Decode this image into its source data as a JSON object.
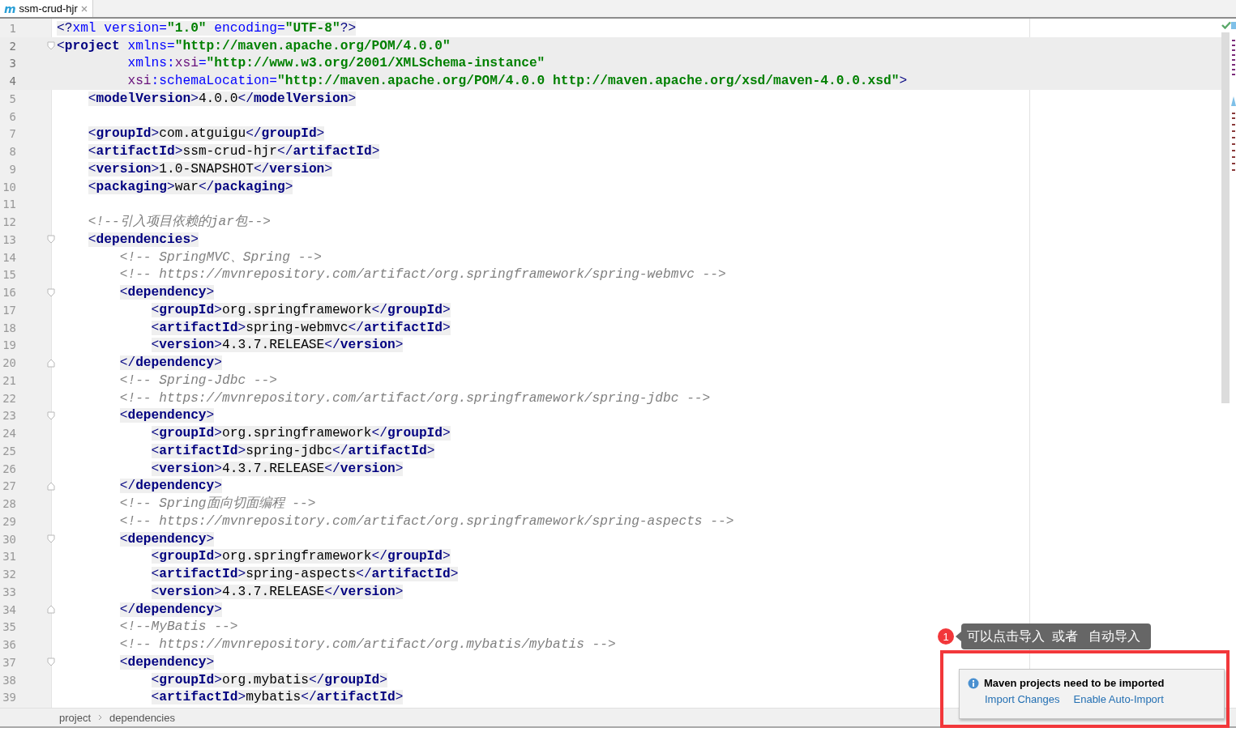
{
  "tabs": [
    {
      "icon": "m",
      "label": "ssm-crud-hjr",
      "selected": true
    }
  ],
  "lines": [
    {
      "number": "1",
      "highlighted": false,
      "fold_start": false,
      "fold_end": false,
      "tokens": [
        {
          "kind": "punct",
          "text": "<?"
        },
        {
          "kind": "attr",
          "text": "xml version="
        },
        {
          "kind": "value",
          "text": "\"1.0\""
        },
        {
          "kind": "attr",
          "text": " encoding="
        },
        {
          "kind": "value",
          "text": "\"UTF-8\""
        },
        {
          "kind": "punct",
          "text": "?>"
        }
      ]
    },
    {
      "number": "2",
      "highlighted": true,
      "fold_start": true,
      "fold_end": false,
      "tokens": [
        {
          "kind": "punct",
          "text": "<"
        },
        {
          "kind": "tag",
          "text": "project"
        },
        {
          "kind": "attr",
          "text": " xmlns="
        },
        {
          "kind": "value",
          "text": "\"http://maven.apache.org/POM/4.0.0\""
        }
      ]
    },
    {
      "number": "3",
      "highlighted": true,
      "fold_start": false,
      "fold_end": false,
      "tokens": [
        {
          "kind": "attr",
          "text": "         xmlns:"
        },
        {
          "kind": "ns",
          "text": "xsi"
        },
        {
          "kind": "attr",
          "text": "="
        },
        {
          "kind": "value",
          "text": "\"http://www.w3.org/2001/XMLSchema-instance\""
        }
      ]
    },
    {
      "number": "4",
      "highlighted": true,
      "fold_start": false,
      "fold_end": false,
      "tokens": [
        {
          "kind": "ns",
          "text": "         xsi"
        },
        {
          "kind": "attr",
          "text": ":schemaLocation="
        },
        {
          "kind": "value",
          "text": "\"http://maven.apache.org/POM/4.0.0 http://maven.apache.org/xsd/maven-4.0.0.xsd\""
        },
        {
          "kind": "punct",
          "text": ">"
        }
      ]
    },
    {
      "number": "5",
      "highlighted": false,
      "fold_start": false,
      "fold_end": false,
      "tokens": [
        {
          "kind": "punct",
          "text": "    <"
        },
        {
          "kind": "tag",
          "text": "modelVersion"
        },
        {
          "kind": "punct",
          "text": ">"
        },
        {
          "kind": "text",
          "text": "4.0.0"
        },
        {
          "kind": "punct",
          "text": "</"
        },
        {
          "kind": "tag",
          "text": "modelVersion"
        },
        {
          "kind": "punct",
          "text": ">"
        }
      ]
    },
    {
      "number": "6",
      "highlighted": false,
      "fold_start": false,
      "fold_end": false
    },
    {
      "number": "7",
      "highlighted": false,
      "fold_start": false,
      "fold_end": false,
      "tokens": [
        {
          "kind": "punct",
          "text": "    <"
        },
        {
          "kind": "tag",
          "text": "groupId"
        },
        {
          "kind": "punct",
          "text": ">"
        },
        {
          "kind": "text",
          "text": "com.atguigu"
        },
        {
          "kind": "punct",
          "text": "</"
        },
        {
          "kind": "tag",
          "text": "groupId"
        },
        {
          "kind": "punct",
          "text": ">"
        }
      ]
    },
    {
      "number": "8",
      "highlighted": false,
      "fold_start": false,
      "fold_end": false,
      "tokens": [
        {
          "kind": "punct",
          "text": "    <"
        },
        {
          "kind": "tag",
          "text": "artifactId"
        },
        {
          "kind": "punct",
          "text": ">"
        },
        {
          "kind": "text",
          "text": "ssm-crud-hjr"
        },
        {
          "kind": "punct",
          "text": "</"
        },
        {
          "kind": "tag",
          "text": "artifactId"
        },
        {
          "kind": "punct",
          "text": ">"
        }
      ]
    },
    {
      "number": "9",
      "highlighted": false,
      "fold_start": false,
      "fold_end": false,
      "tokens": [
        {
          "kind": "punct",
          "text": "    <"
        },
        {
          "kind": "tag",
          "text": "version"
        },
        {
          "kind": "punct",
          "text": ">"
        },
        {
          "kind": "text",
          "text": "1.0-SNAPSHOT"
        },
        {
          "kind": "punct",
          "text": "</"
        },
        {
          "kind": "tag",
          "text": "version"
        },
        {
          "kind": "punct",
          "text": ">"
        }
      ]
    },
    {
      "number": "10",
      "highlighted": false,
      "fold_start": false,
      "fold_end": false,
      "tokens": [
        {
          "kind": "punct",
          "text": "    <"
        },
        {
          "kind": "tag",
          "text": "packaging"
        },
        {
          "kind": "punct",
          "text": ">"
        },
        {
          "kind": "text",
          "text": "war"
        },
        {
          "kind": "punct",
          "text": "</"
        },
        {
          "kind": "tag",
          "text": "packaging"
        },
        {
          "kind": "punct",
          "text": ">"
        }
      ]
    },
    {
      "number": "11",
      "highlighted": false,
      "fold_start": false,
      "fold_end": false
    },
    {
      "number": "12",
      "highlighted": false,
      "fold_start": false,
      "fold_end": false,
      "tokens": [
        {
          "kind": "comment",
          "text": "    <!--引入项目依赖的jar包-->"
        }
      ]
    },
    {
      "number": "13",
      "highlighted": false,
      "fold_start": true,
      "fold_end": false,
      "tokens": [
        {
          "kind": "punct",
          "text": "    <"
        },
        {
          "kind": "tag",
          "text": "dependencies"
        },
        {
          "kind": "punct",
          "text": ">"
        }
      ]
    },
    {
      "number": "14",
      "highlighted": false,
      "fold_start": false,
      "fold_end": false,
      "tokens": [
        {
          "kind": "comment",
          "text": "        <!-- SpringMVC、Spring -->"
        }
      ]
    },
    {
      "number": "15",
      "highlighted": false,
      "fold_start": false,
      "fold_end": false,
      "tokens": [
        {
          "kind": "comment",
          "text": "        <!-- https://mvnrepository.com/artifact/org.springframework/spring-webmvc -->"
        }
      ]
    },
    {
      "number": "16",
      "highlighted": false,
      "fold_start": true,
      "fold_end": false,
      "tokens": [
        {
          "kind": "punct",
          "text": "        <"
        },
        {
          "kind": "tag",
          "text": "dependency"
        },
        {
          "kind": "punct",
          "text": ">"
        }
      ]
    },
    {
      "number": "17",
      "highlighted": false,
      "fold_start": false,
      "fold_end": false,
      "tokens": [
        {
          "kind": "punct",
          "text": "            <"
        },
        {
          "kind": "tag",
          "text": "groupId"
        },
        {
          "kind": "punct",
          "text": ">"
        },
        {
          "kind": "text",
          "text": "org.springframework"
        },
        {
          "kind": "punct",
          "text": "</"
        },
        {
          "kind": "tag",
          "text": "groupId"
        },
        {
          "kind": "punct",
          "text": ">"
        }
      ]
    },
    {
      "number": "18",
      "highlighted": false,
      "fold_start": false,
      "fold_end": false,
      "tokens": [
        {
          "kind": "punct",
          "text": "            <"
        },
        {
          "kind": "tag",
          "text": "artifactId"
        },
        {
          "kind": "punct",
          "text": ">"
        },
        {
          "kind": "text",
          "text": "spring-webmvc"
        },
        {
          "kind": "punct",
          "text": "</"
        },
        {
          "kind": "tag",
          "text": "artifactId"
        },
        {
          "kind": "punct",
          "text": ">"
        }
      ]
    },
    {
      "number": "19",
      "highlighted": false,
      "fold_start": false,
      "fold_end": false,
      "tokens": [
        {
          "kind": "punct",
          "text": "            <"
        },
        {
          "kind": "tag",
          "text": "version"
        },
        {
          "kind": "punct",
          "text": ">"
        },
        {
          "kind": "text",
          "text": "4.3.7.RELEASE"
        },
        {
          "kind": "punct",
          "text": "</"
        },
        {
          "kind": "tag",
          "text": "version"
        },
        {
          "kind": "punct",
          "text": ">"
        }
      ]
    },
    {
      "number": "20",
      "highlighted": false,
      "fold_start": false,
      "fold_end": true,
      "tokens": [
        {
          "kind": "punct",
          "text": "        </"
        },
        {
          "kind": "tag",
          "text": "dependency"
        },
        {
          "kind": "punct",
          "text": ">"
        }
      ]
    },
    {
      "number": "21",
      "highlighted": false,
      "fold_start": false,
      "fold_end": false,
      "tokens": [
        {
          "kind": "comment",
          "text": "        <!-- Spring-Jdbc -->"
        }
      ]
    },
    {
      "number": "22",
      "highlighted": false,
      "fold_start": false,
      "fold_end": false,
      "tokens": [
        {
          "kind": "comment",
          "text": "        <!-- https://mvnrepository.com/artifact/org.springframework/spring-jdbc -->"
        }
      ]
    },
    {
      "number": "23",
      "highlighted": false,
      "fold_start": true,
      "fold_end": false,
      "tokens": [
        {
          "kind": "punct",
          "text": "        <"
        },
        {
          "kind": "tag",
          "text": "dependency"
        },
        {
          "kind": "punct",
          "text": ">"
        }
      ]
    },
    {
      "number": "24",
      "highlighted": false,
      "fold_start": false,
      "fold_end": false,
      "tokens": [
        {
          "kind": "punct",
          "text": "            <"
        },
        {
          "kind": "tag",
          "text": "groupId"
        },
        {
          "kind": "punct",
          "text": ">"
        },
        {
          "kind": "text",
          "text": "org.springframework"
        },
        {
          "kind": "punct",
          "text": "</"
        },
        {
          "kind": "tag",
          "text": "groupId"
        },
        {
          "kind": "punct",
          "text": ">"
        }
      ]
    },
    {
      "number": "25",
      "highlighted": false,
      "fold_start": false,
      "fold_end": false,
      "tokens": [
        {
          "kind": "punct",
          "text": "            <"
        },
        {
          "kind": "tag",
          "text": "artifactId"
        },
        {
          "kind": "punct",
          "text": ">"
        },
        {
          "kind": "text",
          "text": "spring-jdbc"
        },
        {
          "kind": "punct",
          "text": "</"
        },
        {
          "kind": "tag",
          "text": "artifactId"
        },
        {
          "kind": "punct",
          "text": ">"
        }
      ]
    },
    {
      "number": "26",
      "highlighted": false,
      "fold_start": false,
      "fold_end": false,
      "tokens": [
        {
          "kind": "punct",
          "text": "            <"
        },
        {
          "kind": "tag",
          "text": "version"
        },
        {
          "kind": "punct",
          "text": ">"
        },
        {
          "kind": "text",
          "text": "4.3.7.RELEASE"
        },
        {
          "kind": "punct",
          "text": "</"
        },
        {
          "kind": "tag",
          "text": "version"
        },
        {
          "kind": "punct",
          "text": ">"
        }
      ]
    },
    {
      "number": "27",
      "highlighted": false,
      "fold_start": false,
      "fold_end": true,
      "tokens": [
        {
          "kind": "punct",
          "text": "        </"
        },
        {
          "kind": "tag",
          "text": "dependency"
        },
        {
          "kind": "punct",
          "text": ">"
        }
      ]
    },
    {
      "number": "28",
      "highlighted": false,
      "fold_start": false,
      "fold_end": false,
      "tokens": [
        {
          "kind": "comment",
          "text": "        <!-- Spring面向切面编程 -->"
        }
      ]
    },
    {
      "number": "29",
      "highlighted": false,
      "fold_start": false,
      "fold_end": false,
      "tokens": [
        {
          "kind": "comment",
          "text": "        <!-- https://mvnrepository.com/artifact/org.springframework/spring-aspects -->"
        }
      ]
    },
    {
      "number": "30",
      "highlighted": false,
      "fold_start": true,
      "fold_end": false,
      "tokens": [
        {
          "kind": "punct",
          "text": "        <"
        },
        {
          "kind": "tag",
          "text": "dependency"
        },
        {
          "kind": "punct",
          "text": ">"
        }
      ]
    },
    {
      "number": "31",
      "highlighted": false,
      "fold_start": false,
      "fold_end": false,
      "tokens": [
        {
          "kind": "punct",
          "text": "            <"
        },
        {
          "kind": "tag",
          "text": "groupId"
        },
        {
          "kind": "punct",
          "text": ">"
        },
        {
          "kind": "text",
          "text": "org.springframework"
        },
        {
          "kind": "punct",
          "text": "</"
        },
        {
          "kind": "tag",
          "text": "groupId"
        },
        {
          "kind": "punct",
          "text": ">"
        }
      ]
    },
    {
      "number": "32",
      "highlighted": false,
      "fold_start": false,
      "fold_end": false,
      "tokens": [
        {
          "kind": "punct",
          "text": "            <"
        },
        {
          "kind": "tag",
          "text": "artifactId"
        },
        {
          "kind": "punct",
          "text": ">"
        },
        {
          "kind": "text",
          "text": "spring-aspects"
        },
        {
          "kind": "punct",
          "text": "</"
        },
        {
          "kind": "tag",
          "text": "artifactId"
        },
        {
          "kind": "punct",
          "text": ">"
        }
      ]
    },
    {
      "number": "33",
      "highlighted": false,
      "fold_start": false,
      "fold_end": false,
      "tokens": [
        {
          "kind": "punct",
          "text": "            <"
        },
        {
          "kind": "tag",
          "text": "version"
        },
        {
          "kind": "punct",
          "text": ">"
        },
        {
          "kind": "text",
          "text": "4.3.7.RELEASE"
        },
        {
          "kind": "punct",
          "text": "</"
        },
        {
          "kind": "tag",
          "text": "version"
        },
        {
          "kind": "punct",
          "text": ">"
        }
      ]
    },
    {
      "number": "34",
      "highlighted": false,
      "fold_start": false,
      "fold_end": true,
      "tokens": [
        {
          "kind": "punct",
          "text": "        </"
        },
        {
          "kind": "tag",
          "text": "dependency"
        },
        {
          "kind": "punct",
          "text": ">"
        }
      ]
    },
    {
      "number": "35",
      "highlighted": false,
      "fold_start": false,
      "fold_end": false,
      "tokens": [
        {
          "kind": "comment",
          "text": "        <!--MyBatis -->"
        }
      ]
    },
    {
      "number": "36",
      "highlighted": false,
      "fold_start": false,
      "fold_end": false,
      "tokens": [
        {
          "kind": "comment",
          "text": "        <!-- https://mvnrepository.com/artifact/org.mybatis/mybatis -->"
        }
      ]
    },
    {
      "number": "37",
      "highlighted": false,
      "fold_start": true,
      "fold_end": false,
      "tokens": [
        {
          "kind": "punct",
          "text": "        <"
        },
        {
          "kind": "tag",
          "text": "dependency"
        },
        {
          "kind": "punct",
          "text": ">"
        }
      ]
    },
    {
      "number": "38",
      "highlighted": false,
      "fold_start": false,
      "fold_end": false,
      "tokens": [
        {
          "kind": "punct",
          "text": "            <"
        },
        {
          "kind": "tag",
          "text": "groupId"
        },
        {
          "kind": "punct",
          "text": ">"
        },
        {
          "kind": "text",
          "text": "org.mybatis"
        },
        {
          "kind": "punct",
          "text": "</"
        },
        {
          "kind": "tag",
          "text": "groupId"
        },
        {
          "kind": "punct",
          "text": ">"
        }
      ]
    },
    {
      "number": "39",
      "highlighted": false,
      "fold_start": false,
      "fold_end": false,
      "tokens": [
        {
          "kind": "punct",
          "text": "            <"
        },
        {
          "kind": "tag",
          "text": "artifactId"
        },
        {
          "kind": "punct",
          "text": ">"
        },
        {
          "kind": "text",
          "text": "mybatis"
        },
        {
          "kind": "punct",
          "text": "</"
        },
        {
          "kind": "tag",
          "text": "artifactId"
        },
        {
          "kind": "punct",
          "text": ">"
        }
      ]
    }
  ],
  "breadcrumbs": [
    "project",
    "dependencies"
  ],
  "annotation": {
    "badge": "1",
    "text": "可以点击导入  或者   自动导入"
  },
  "notification": {
    "title": "Maven projects need to be imported",
    "links": [
      "Import Changes",
      "Enable Auto-Import"
    ]
  }
}
